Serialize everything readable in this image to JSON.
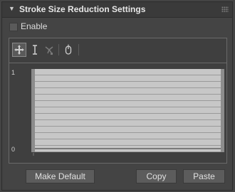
{
  "header": {
    "title": "Stroke Size Reduction Settings"
  },
  "enable": {
    "label": "Enable",
    "checked": false
  },
  "toolbar": {
    "tools": [
      {
        "name": "move-point-tool",
        "icon": "move-arrows-icon",
        "active": true
      },
      {
        "name": "scale-point-tool",
        "icon": "vertical-scale-icon",
        "active": false
      },
      {
        "name": "insert-point-tool",
        "icon": "insert-point-icon",
        "disabled": true
      },
      {
        "name": "reset-curve-tool",
        "icon": "mouse-icon",
        "active": false
      }
    ]
  },
  "graph": {
    "y_top_label": "1",
    "y_bottom_label": "0"
  },
  "buttons": {
    "make_default": "Make Default",
    "copy": "Copy",
    "paste": "Paste"
  },
  "colors": {
    "panel_bg": "#444444",
    "header_bg": "#3a3a3a",
    "plot_bg": "#c7c7c7",
    "button_bg": "#5c5c5c"
  }
}
